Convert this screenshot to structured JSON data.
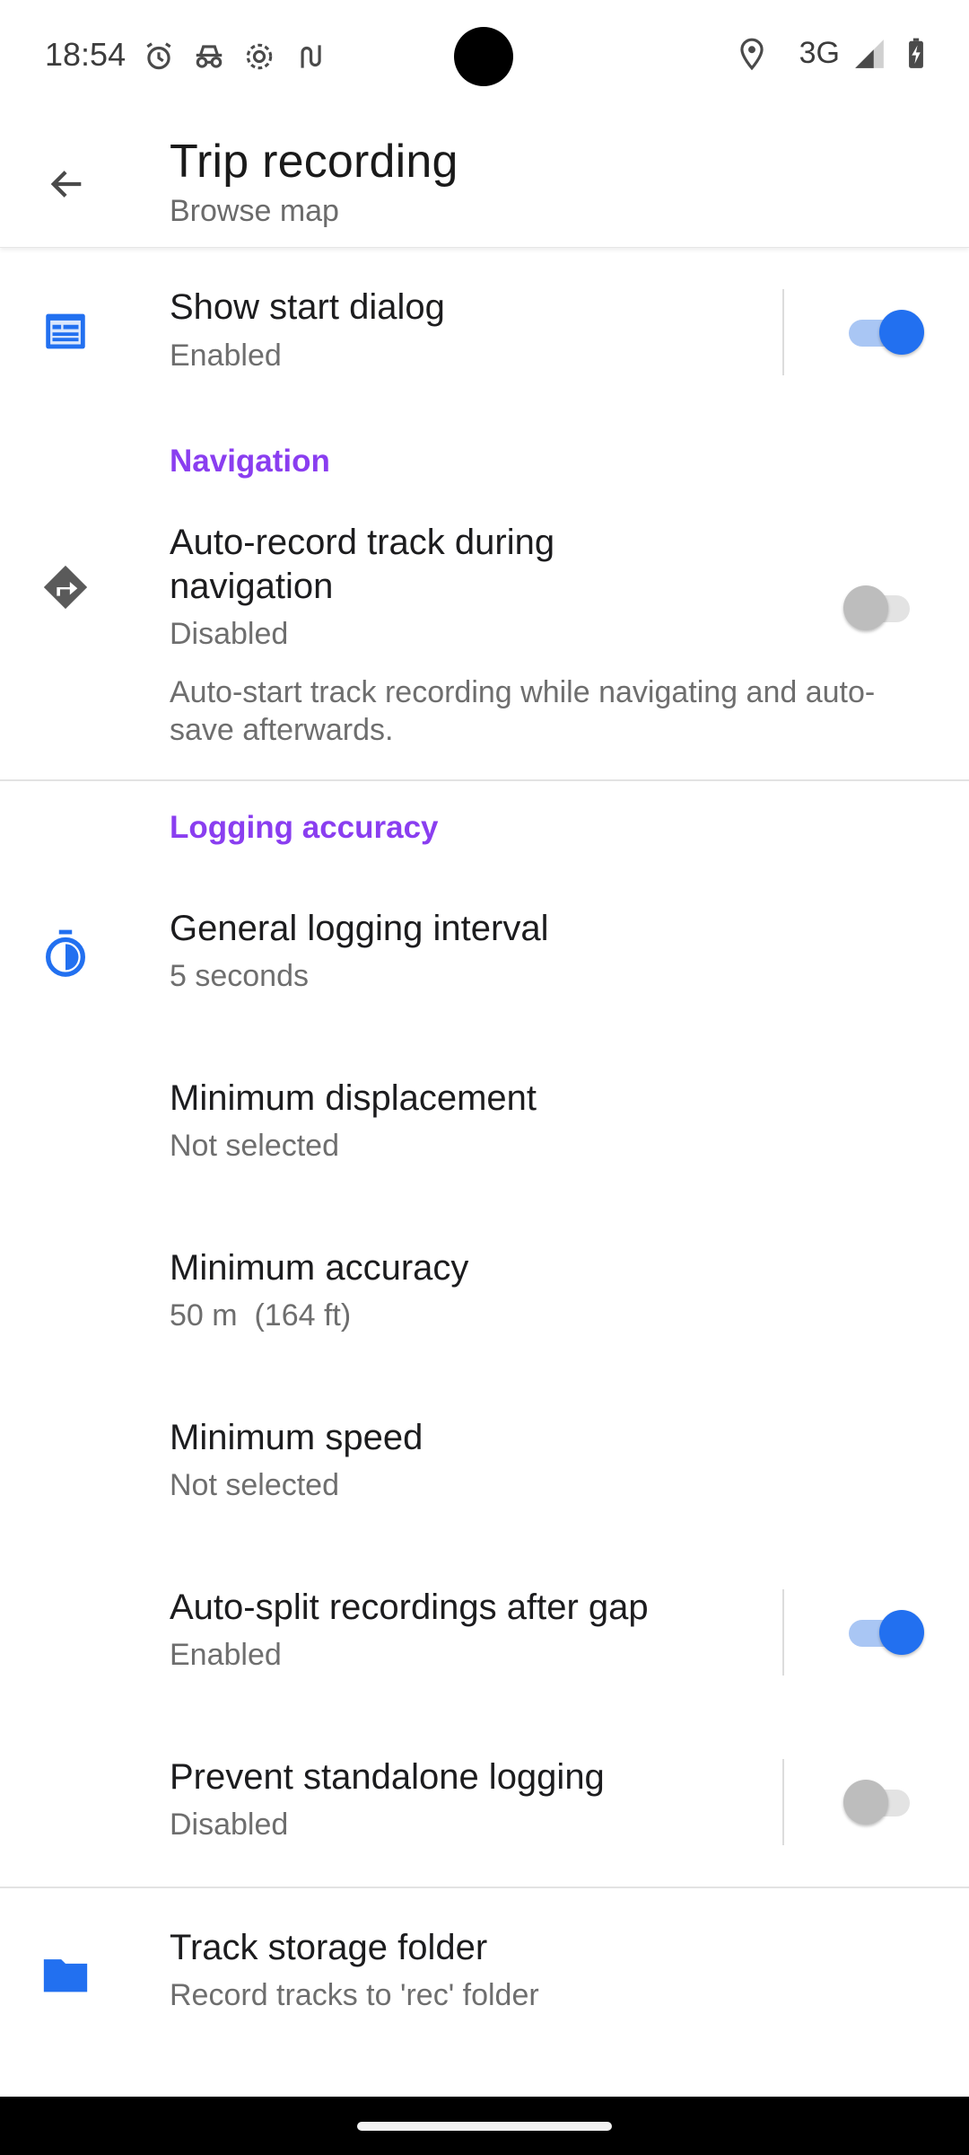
{
  "status_bar": {
    "time": "18:54",
    "icons_left": [
      "alarm-icon",
      "incognito-icon",
      "settings-icon",
      "usb-icon"
    ],
    "network": "3G",
    "icons_right": [
      "location-icon",
      "signal-icon",
      "battery-charging-icon"
    ]
  },
  "app_bar": {
    "title": "Trip recording",
    "subtitle": "Browse map"
  },
  "settings": {
    "show_start_dialog": {
      "title": "Show start dialog",
      "state": "Enabled",
      "enabled": true,
      "icon": "dialog-icon"
    },
    "navigation_header": "Navigation",
    "auto_record": {
      "title": "Auto-record track during navigation",
      "state": "Disabled",
      "enabled": false,
      "description": "Auto-start track recording while navigating and auto-save afterwards.",
      "icon": "turn-right-icon"
    },
    "logging_header": "Logging accuracy",
    "general_interval": {
      "title": "General logging interval",
      "value": "5 seconds",
      "icon": "timer-icon"
    },
    "min_displacement": {
      "title": "Minimum displacement",
      "value": "Not selected"
    },
    "min_accuracy": {
      "title": "Minimum accuracy",
      "value": "50 m  (164 ft)"
    },
    "min_speed": {
      "title": "Minimum speed",
      "value": "Not selected"
    },
    "auto_split": {
      "title": "Auto-split recordings after gap",
      "state": "Enabled",
      "enabled": true
    },
    "prevent_standalone": {
      "title": "Prevent standalone logging",
      "state": "Disabled",
      "enabled": false
    },
    "storage_folder": {
      "title": "Track storage folder",
      "value": "Record tracks to 'rec' folder",
      "icon": "folder-icon"
    }
  },
  "colors": {
    "accent": "#2270f0",
    "section_header": "#8a3ef0",
    "icon_blue": "#2270f0",
    "icon_gray": "#5a5a5a"
  }
}
